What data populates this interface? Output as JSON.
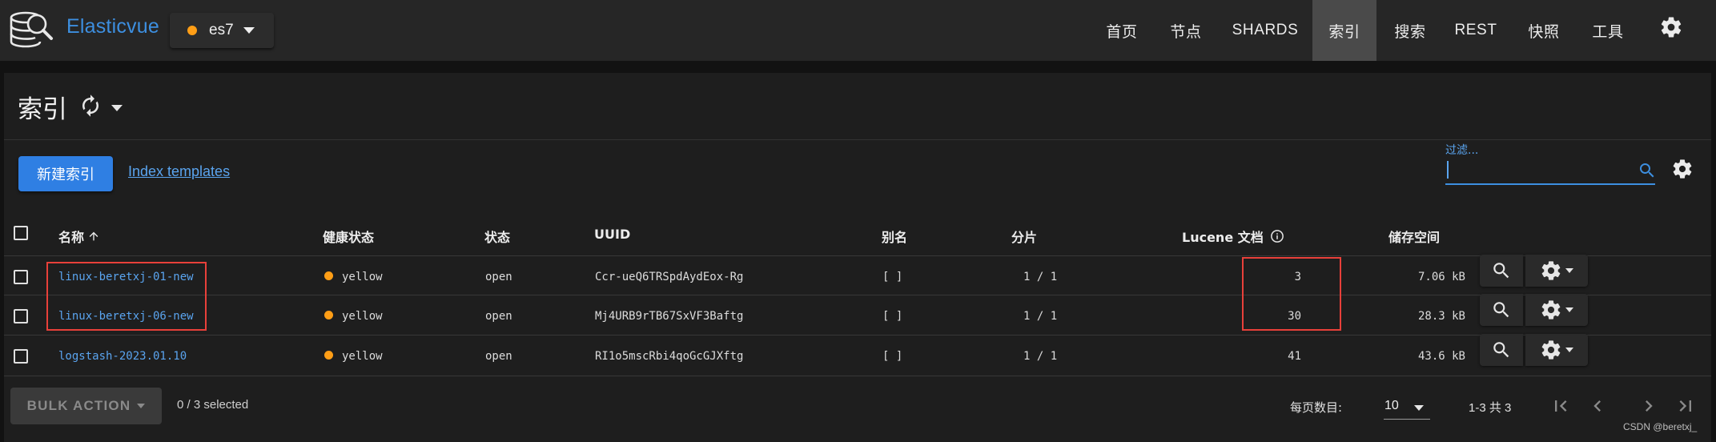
{
  "app": {
    "brand": "Elasticvue",
    "cluster_name": "es7",
    "cluster_status_color": "#ff9e16",
    "accent_color": "#3d8fe0"
  },
  "nav": [
    {
      "label": "首页",
      "active": false
    },
    {
      "label": "节点",
      "active": false
    },
    {
      "label": "SHARDS",
      "active": false
    },
    {
      "label": "索引",
      "active": true
    },
    {
      "label": "搜索",
      "active": false
    },
    {
      "label": "REST",
      "active": false
    },
    {
      "label": "快照",
      "active": false
    },
    {
      "label": "工具",
      "active": false
    }
  ],
  "page": {
    "title": "索引",
    "new_index_label": "新建索引",
    "templates_link": "Index templates",
    "filter_label": "过滤...",
    "filter_value": ""
  },
  "table": {
    "headers": {
      "name": "名称",
      "health": "健康状态",
      "status": "状态",
      "uuid": "UUID",
      "aliases": "别名",
      "shards": "分片",
      "lucene_docs": "Lucene 文档",
      "storage": "储存空间"
    },
    "rows": [
      {
        "name": "linux-beretxj-01-new",
        "health": "yellow",
        "status": "open",
        "uuid": "Ccr-ueQ6TRSpdAydEox-Rg",
        "aliases": "[ ]",
        "shards": "1 / 1",
        "docs": "3",
        "size": "7.06 kB"
      },
      {
        "name": "linux-beretxj-06-new",
        "health": "yellow",
        "status": "open",
        "uuid": "Mj4URB9rTB67SxVF3Baftg",
        "aliases": "[ ]",
        "shards": "1 / 1",
        "docs": "30",
        "size": "28.3 kB"
      },
      {
        "name": "logstash-2023.01.10",
        "health": "yellow",
        "status": "open",
        "uuid": "RI1o5mscRbi4qoGcGJXftg",
        "aliases": "[ ]",
        "shards": "1 / 1",
        "docs": "41",
        "size": "43.6 kB"
      }
    ]
  },
  "footer": {
    "bulk_action": "BULK ACTION",
    "selected": "0 / 3 selected",
    "per_page_label": "每页数目:",
    "per_page_value": "10",
    "range": "1-3 共 3"
  },
  "watermark": "CSDN @beretxj_"
}
